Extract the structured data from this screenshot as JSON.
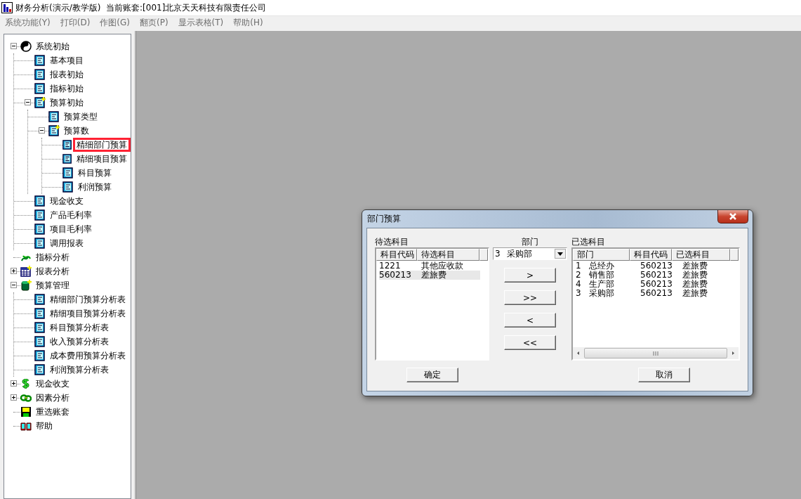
{
  "window": {
    "title": "财务分析(演示/教学版)  当前账套:[001]北京天天科技有限责任公司"
  },
  "menu": [
    "系统功能(Y)",
    "打印(D)",
    "作图(G)",
    "翻页(P)",
    "显示表格(T)",
    "帮助(H)"
  ],
  "tree": [
    {
      "label": "系统初始",
      "kind": "yinyang",
      "expanded": true,
      "highlighted": false,
      "children": [
        {
          "label": "基本项目",
          "kind": "doc",
          "highlighted": false
        },
        {
          "label": "报表初始",
          "kind": "doc",
          "highlighted": false
        },
        {
          "label": "指标初始",
          "kind": "doc",
          "highlighted": false
        },
        {
          "label": "预算初始",
          "kind": "docplus",
          "expanded": true,
          "highlighted": false,
          "children": [
            {
              "label": "预算类型",
              "kind": "doc",
              "highlighted": false
            },
            {
              "label": "预算数",
              "kind": "docplus",
              "expanded": true,
              "highlighted": false,
              "children": [
                {
                  "label": "精细部门预算",
                  "kind": "doc",
                  "highlighted": true
                },
                {
                  "label": "精细项目预算",
                  "kind": "doc",
                  "highlighted": false
                },
                {
                  "label": "科目预算",
                  "kind": "doc",
                  "highlighted": false
                },
                {
                  "label": "利润预算",
                  "kind": "doc",
                  "highlighted": false
                }
              ]
            }
          ]
        },
        {
          "label": "现金收支",
          "kind": "doc",
          "highlighted": false
        },
        {
          "label": "产品毛利率",
          "kind": "doc",
          "highlighted": false
        },
        {
          "label": "项目毛利率",
          "kind": "doc",
          "highlighted": false
        },
        {
          "label": "调用报表",
          "kind": "doc",
          "highlighted": false
        }
      ]
    },
    {
      "label": "指标分析",
      "kind": "squiggle",
      "highlighted": false
    },
    {
      "label": "报表分析",
      "kind": "tableplus",
      "expanded": false,
      "highlighted": false
    },
    {
      "label": "预算管理",
      "kind": "canplus",
      "expanded": true,
      "highlighted": false,
      "children": [
        {
          "label": "精细部门预算分析表",
          "kind": "doc",
          "highlighted": false
        },
        {
          "label": "精细项目预算分析表",
          "kind": "doc",
          "highlighted": false
        },
        {
          "label": "科目预算分析表",
          "kind": "doc",
          "highlighted": false
        },
        {
          "label": "收入预算分析表",
          "kind": "doc",
          "highlighted": false
        },
        {
          "label": "成本费用预算分析表",
          "kind": "doc",
          "highlighted": false
        },
        {
          "label": "利润预算分析表",
          "kind": "doc",
          "highlighted": false
        }
      ]
    },
    {
      "label": "现金收支",
      "kind": "dollar",
      "expanded": false,
      "highlighted": false
    },
    {
      "label": "因素分析",
      "kind": "chain",
      "expanded": false,
      "highlighted": false
    },
    {
      "label": "重选账套",
      "kind": "floppy",
      "highlighted": false
    },
    {
      "label": "帮助",
      "kind": "book",
      "highlighted": false
    }
  ],
  "dialog": {
    "title": "部门预算",
    "candidates": {
      "label": "待选科目",
      "columns": [
        "科目代码",
        "待选科目"
      ],
      "rows": [
        {
          "cells": [
            "1221",
            "其他应收款"
          ],
          "selected": false
        },
        {
          "cells": [
            "560213",
            "差旅费"
          ],
          "selected": true
        }
      ]
    },
    "department": {
      "label": "部门",
      "code": "3",
      "name": "采购部"
    },
    "move_buttons": [
      ">",
      ">>",
      "<",
      "<<"
    ],
    "chosen": {
      "label": "已选科目",
      "columns": [
        "部门",
        "科目代码",
        "已选科目"
      ],
      "rows": [
        {
          "cells": [
            "1   总经办",
            "560213",
            "差旅费"
          ]
        },
        {
          "cells": [
            "2   销售部",
            "560213",
            "差旅费"
          ]
        },
        {
          "cells": [
            "4   生产部",
            "560213",
            "差旅费"
          ]
        },
        {
          "cells": [
            "3   采购部",
            "560213",
            "差旅费"
          ]
        }
      ]
    },
    "ok_button": "确定",
    "cancel_button": "取消"
  }
}
